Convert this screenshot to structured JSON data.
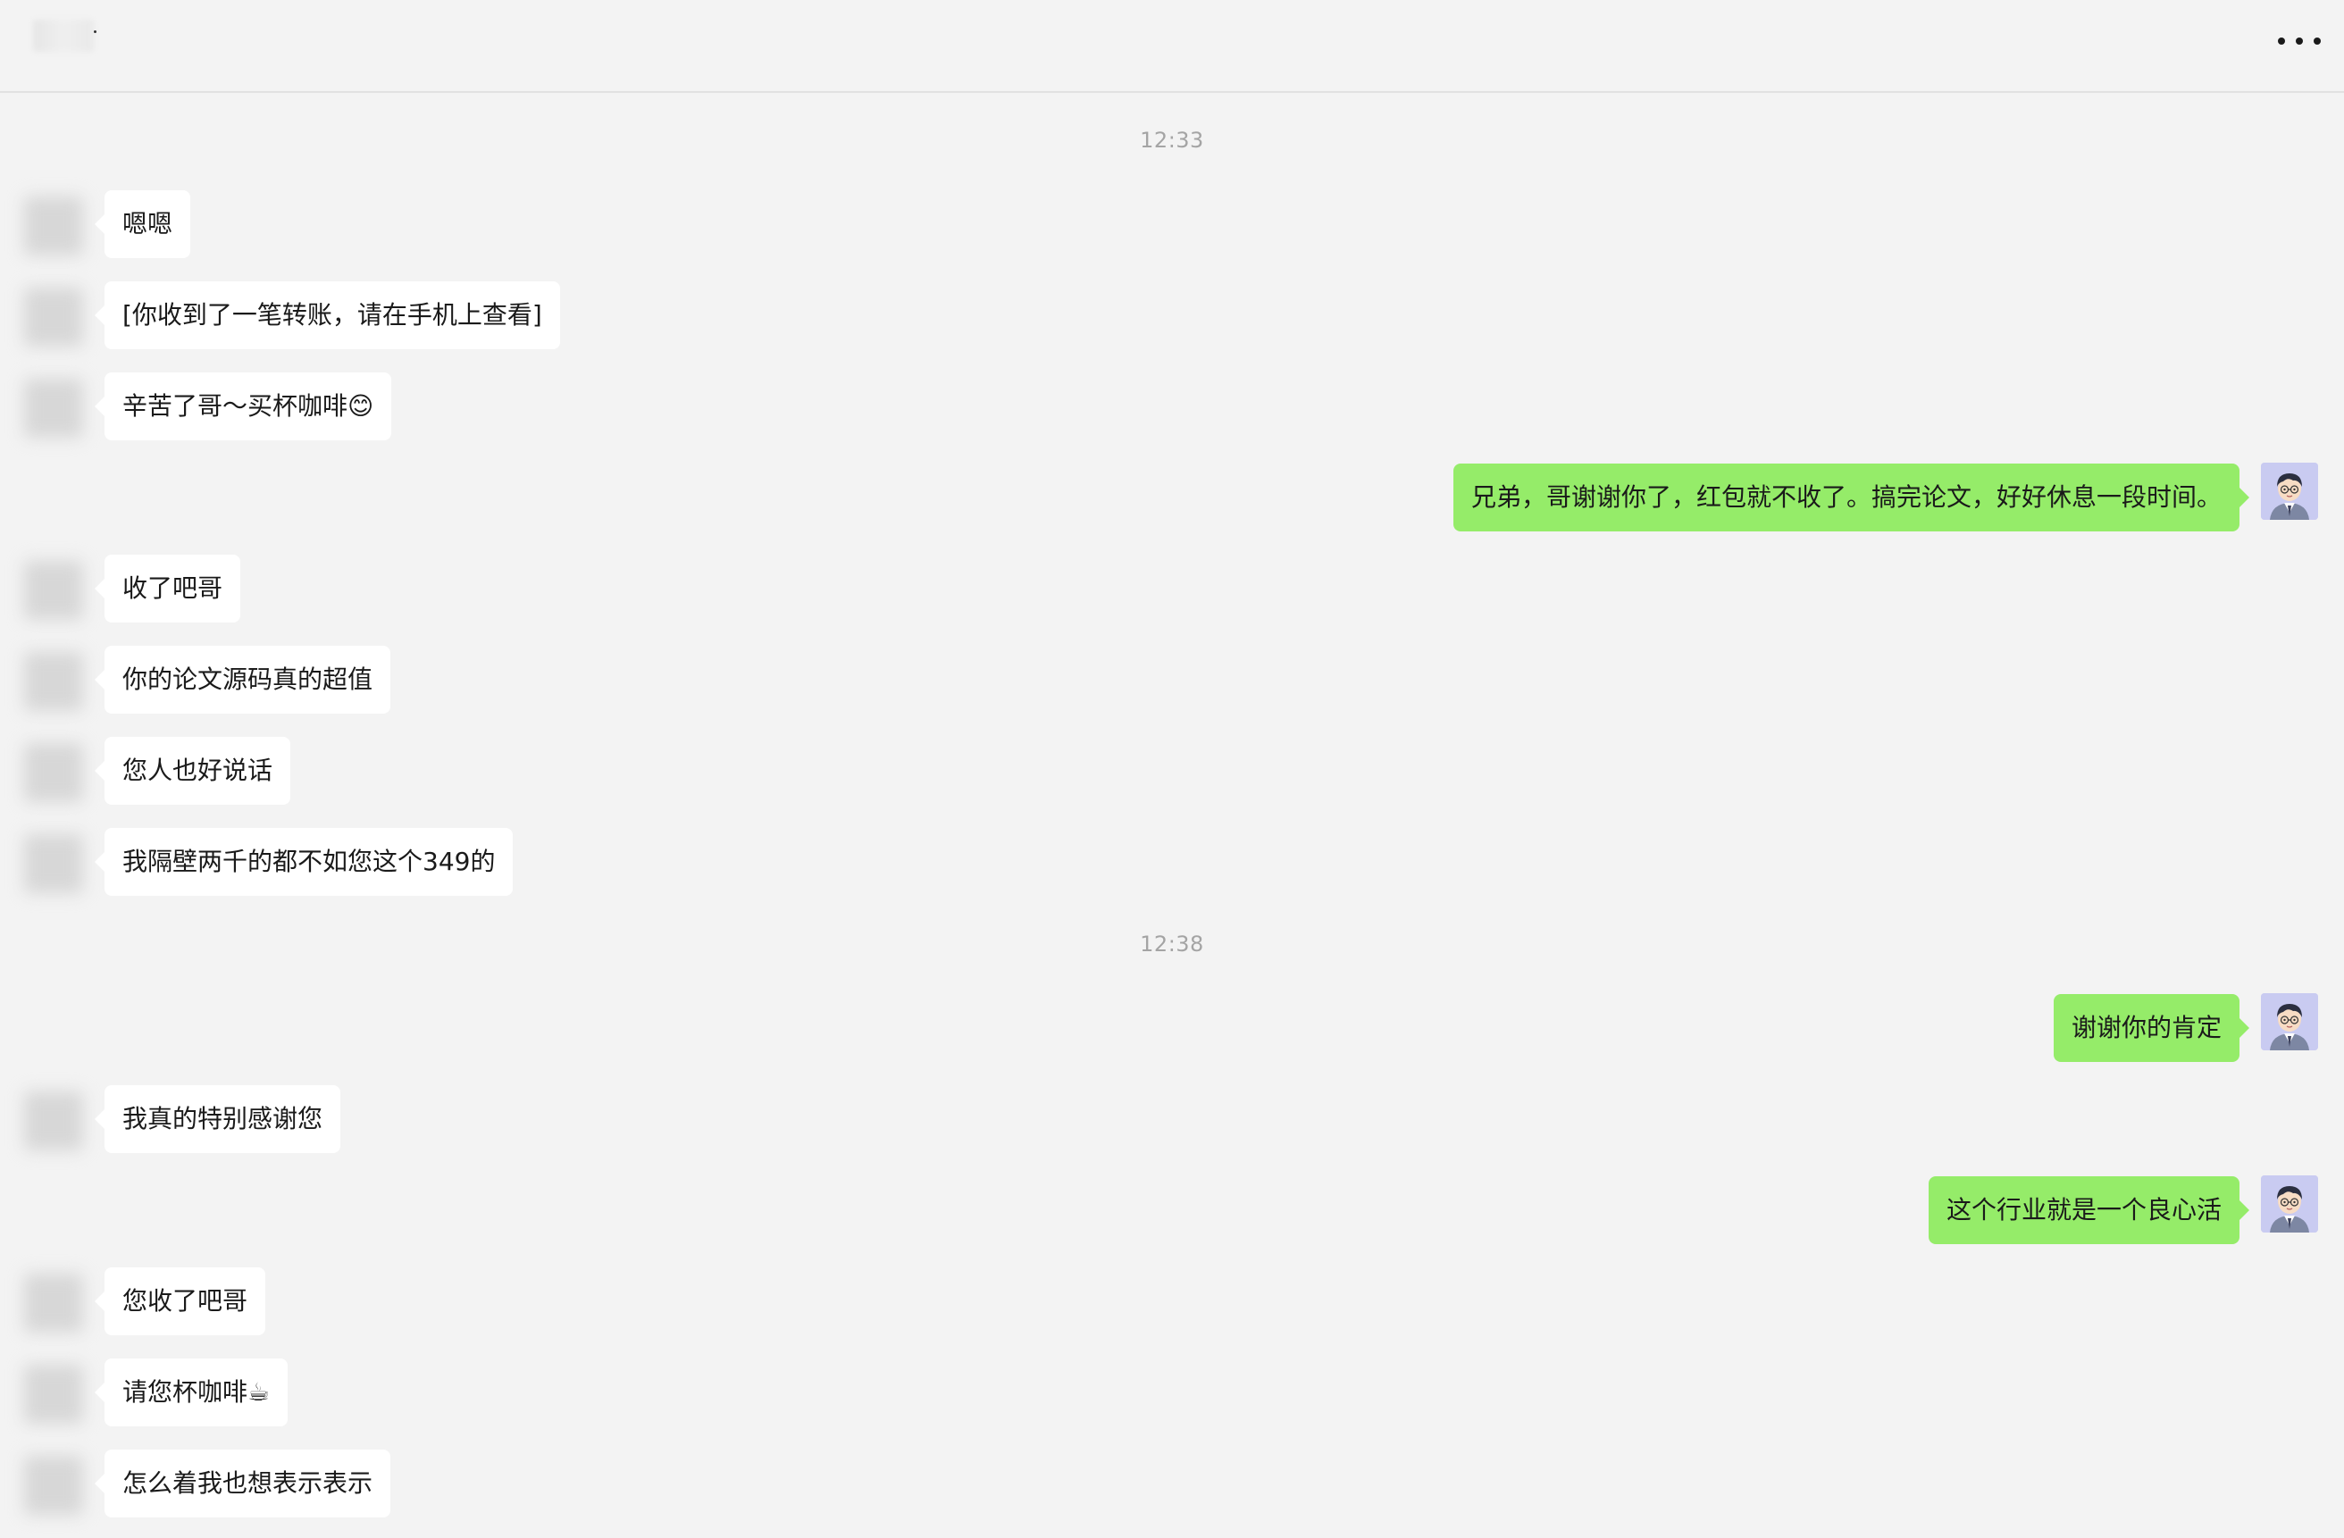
{
  "header": {
    "more_icon": "more-dots-icon"
  },
  "timestamps": [
    "12:33",
    "12:38"
  ],
  "messages": [
    {
      "side": "left",
      "text": "嗯嗯"
    },
    {
      "side": "left",
      "text": "[你收到了一笔转账，请在手机上查看]"
    },
    {
      "side": "left",
      "text": "辛苦了哥～买杯咖啡😊"
    },
    {
      "side": "right",
      "text": "兄弟，哥谢谢你了，红包就不收了。搞完论文，好好休息一段时间。"
    },
    {
      "side": "left",
      "text": "收了吧哥"
    },
    {
      "side": "left",
      "text": "你的论文源码真的超值"
    },
    {
      "side": "left",
      "text": "您人也好说话"
    },
    {
      "side": "left",
      "text": "我隔壁两千的都不如您这个349的"
    },
    {
      "side": "right",
      "text": "谢谢你的肯定"
    },
    {
      "side": "left",
      "text": "我真的特别感谢您"
    },
    {
      "side": "right",
      "text": "这个行业就是一个良心活"
    },
    {
      "side": "left",
      "text": "您收了吧哥"
    },
    {
      "side": "left",
      "text": "请您杯咖啡☕"
    },
    {
      "side": "left",
      "text": "怎么着我也想表示表示"
    }
  ],
  "colors": {
    "background": "#f3f3f3",
    "incoming_bubble": "#ffffff",
    "outgoing_bubble": "#95ec69"
  }
}
